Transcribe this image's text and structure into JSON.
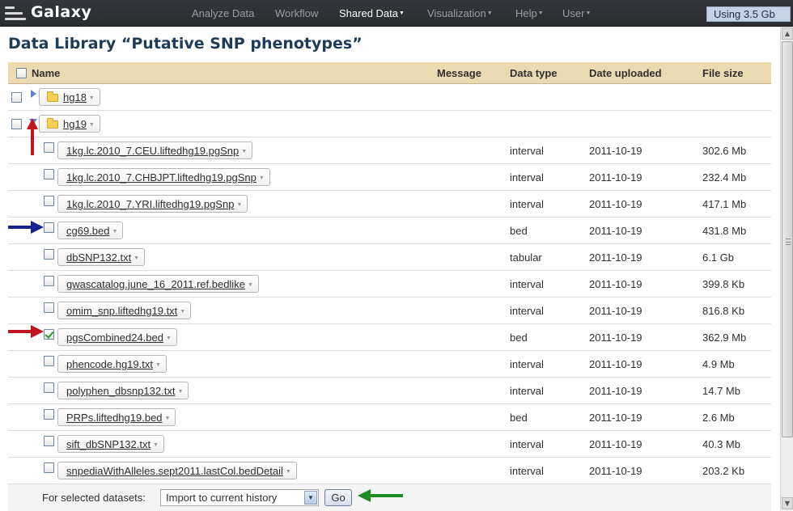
{
  "app": {
    "brand": "Galaxy"
  },
  "nav": [
    {
      "label": "Analyze Data",
      "has_menu": false,
      "active": false
    },
    {
      "label": "Workflow",
      "has_menu": false,
      "active": false
    },
    {
      "label": "Shared Data",
      "has_menu": true,
      "active": true
    },
    {
      "label": "Visualization",
      "has_menu": true,
      "active": false
    },
    {
      "label": "Help",
      "has_menu": true,
      "active": false
    },
    {
      "label": "User",
      "has_menu": true,
      "active": false
    }
  ],
  "quota": "Using 3.5 Gb",
  "page": {
    "title": "Data Library “Putative SNP phenotypes”"
  },
  "table": {
    "headers": {
      "name": "Name",
      "message": "Message",
      "data_type": "Data type",
      "date_uploaded": "Date uploaded",
      "file_size": "File size"
    },
    "folders": [
      {
        "name": "hg18",
        "expanded": false
      },
      {
        "name": "hg19",
        "expanded": true
      }
    ],
    "datasets": [
      {
        "name": "1kg.lc.2010_7.CEU.liftedhg19.pgSnp",
        "type": "interval",
        "date": "2011-10-19",
        "size": "302.6 Mb",
        "checked": false
      },
      {
        "name": "1kg.lc.2010_7.CHBJPT.liftedhg19.pgSnp",
        "type": "interval",
        "date": "2011-10-19",
        "size": "232.4 Mb",
        "checked": false
      },
      {
        "name": "1kg.lc.2010_7.YRI.liftedhg19.pgSnp",
        "type": "interval",
        "date": "2011-10-19",
        "size": "417.1 Mb",
        "checked": false
      },
      {
        "name": "cg69.bed",
        "type": "bed",
        "date": "2011-10-19",
        "size": "431.8 Mb",
        "checked": false
      },
      {
        "name": "dbSNP132.txt",
        "type": "tabular",
        "date": "2011-10-19",
        "size": "6.1 Gb",
        "checked": false
      },
      {
        "name": "gwascatalog.june_16_2011.ref.bedlike",
        "type": "interval",
        "date": "2011-10-19",
        "size": "399.8 Kb",
        "checked": false
      },
      {
        "name": "omim_snp.liftedhg19.txt",
        "type": "interval",
        "date": "2011-10-19",
        "size": "816.8 Kb",
        "checked": false
      },
      {
        "name": "pgsCombined24.bed",
        "type": "bed",
        "date": "2011-10-19",
        "size": "362.9 Mb",
        "checked": true
      },
      {
        "name": "phencode.hg19.txt",
        "type": "interval",
        "date": "2011-10-19",
        "size": "4.9 Mb",
        "checked": false
      },
      {
        "name": "polyphen_dbsnp132.txt",
        "type": "interval",
        "date": "2011-10-19",
        "size": "14.7 Mb",
        "checked": false
      },
      {
        "name": "PRPs.liftedhg19.bed",
        "type": "bed",
        "date": "2011-10-19",
        "size": "2.6 Mb",
        "checked": false
      },
      {
        "name": "sift_dbSNP132.txt",
        "type": "interval",
        "date": "2011-10-19",
        "size": "40.3 Mb",
        "checked": false
      },
      {
        "name": "snpediaWithAlleles.sept2011.lastCol.bedDetail",
        "type": "interval",
        "date": "2011-10-19",
        "size": "203.2 Kb",
        "checked": false
      }
    ]
  },
  "footer": {
    "label": "For selected datasets:",
    "select_value": "Import to current history",
    "go_label": "Go"
  },
  "annotation_colors": {
    "red": "#c0141e",
    "blue": "#14238c",
    "green": "#1e8c23"
  }
}
